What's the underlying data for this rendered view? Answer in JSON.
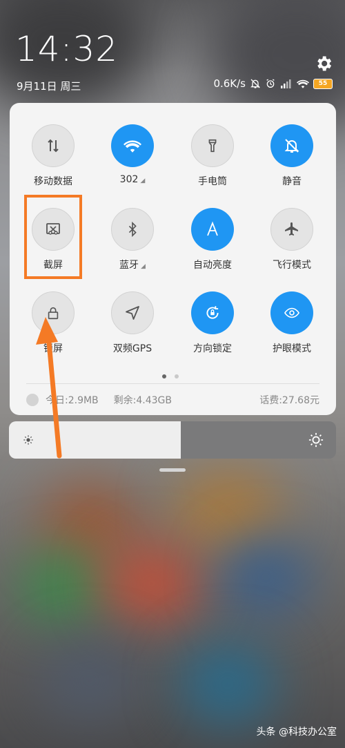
{
  "status": {
    "time": "14:32",
    "date": "9月11日 周三",
    "speed": "0.6K/s",
    "battery": "55"
  },
  "tiles": [
    {
      "label": "移动数据",
      "icon": "mobile-data-icon",
      "on": false
    },
    {
      "label": "302",
      "icon": "wifi-icon",
      "on": true,
      "expand": "◢"
    },
    {
      "label": "手电筒",
      "icon": "flashlight-icon",
      "on": false
    },
    {
      "label": "静音",
      "icon": "mute-bell-icon",
      "on": true
    },
    {
      "label": "截屏",
      "icon": "screenshot-icon",
      "on": false
    },
    {
      "label": "蓝牙",
      "icon": "bluetooth-icon",
      "on": false,
      "expand": "◢"
    },
    {
      "label": "自动亮度",
      "icon": "auto-brightness-icon",
      "on": true
    },
    {
      "label": "飞行模式",
      "icon": "airplane-icon",
      "on": false
    },
    {
      "label": "锁屏",
      "icon": "lock-icon",
      "on": false
    },
    {
      "label": "双频GPS",
      "icon": "gps-icon",
      "on": false
    },
    {
      "label": "方向锁定",
      "icon": "rotation-lock-icon",
      "on": true
    },
    {
      "label": "护眼模式",
      "icon": "eye-icon",
      "on": true
    }
  ],
  "data_usage": {
    "today": "今日:2.9MB",
    "remaining": "剩余:4.43GB",
    "balance": "话费:27.68元"
  },
  "brightness": {
    "level": 0.525
  },
  "watermark": "头条 @科技办公室",
  "colors": {
    "accent": "#1f96f3",
    "highlight": "#f47a25"
  }
}
